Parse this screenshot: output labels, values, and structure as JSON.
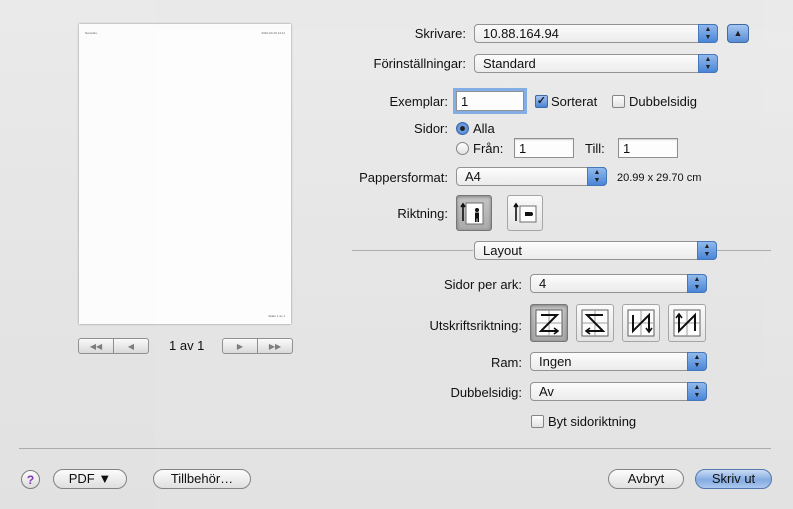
{
  "preview": {
    "header_left": "Namnlös",
    "header_right": "2010-03-15 14:11",
    "footer": "Sidan 1 av 1",
    "page_indicator": "1 av 1",
    "nav_first": "◀◀",
    "nav_prev": "◀",
    "nav_next": "▶",
    "nav_last": "▶▶"
  },
  "printer": {
    "label": "Skrivare:",
    "value": "10.88.164.94"
  },
  "presets": {
    "label": "Förinställningar:",
    "value": "Standard"
  },
  "copies": {
    "label": "Exemplar:",
    "value": "1",
    "collated_label": "Sorterat",
    "collated": true,
    "twosided_label": "Dubbelsidig",
    "twosided": false
  },
  "pages": {
    "label": "Sidor:",
    "all_label": "Alla",
    "from_label": "Från:",
    "from_value": "1",
    "to_label": "Till:",
    "to_value": "1",
    "selected": "all"
  },
  "paper": {
    "label": "Pappersformat:",
    "value": "A4",
    "size": "20.99 x 29.70 cm"
  },
  "orientation": {
    "label": "Riktning:",
    "selected": "portrait"
  },
  "section": {
    "value": "Layout"
  },
  "layout": {
    "pages_per_sheet_label": "Sidor per ark:",
    "pages_per_sheet": "4",
    "direction_label": "Utskriftsriktning:",
    "border_label": "Ram:",
    "border": "Ingen",
    "twosided_label": "Dubbelsidig:",
    "twosided": "Av",
    "flip_label": "Byt sidoriktning",
    "flip": false
  },
  "buttons": {
    "help": "?",
    "pdf": "PDF ▼",
    "supplies": "Tillbehör…",
    "cancel": "Avbryt",
    "print": "Skriv ut"
  },
  "colors": {
    "accent": "#3d7cd3",
    "focus_ring": "#7ba9e6"
  }
}
